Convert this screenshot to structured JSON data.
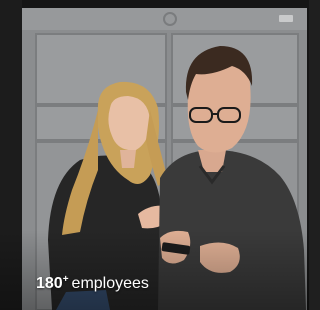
{
  "stat": {
    "number": "180",
    "suffix": "+",
    "label": "employees"
  },
  "photo": {
    "subject": "two-people-looking-at-phone"
  },
  "colors": {
    "background": "#1a1a1a",
    "lockers": "#8a8c8e",
    "text": "#ffffff"
  }
}
